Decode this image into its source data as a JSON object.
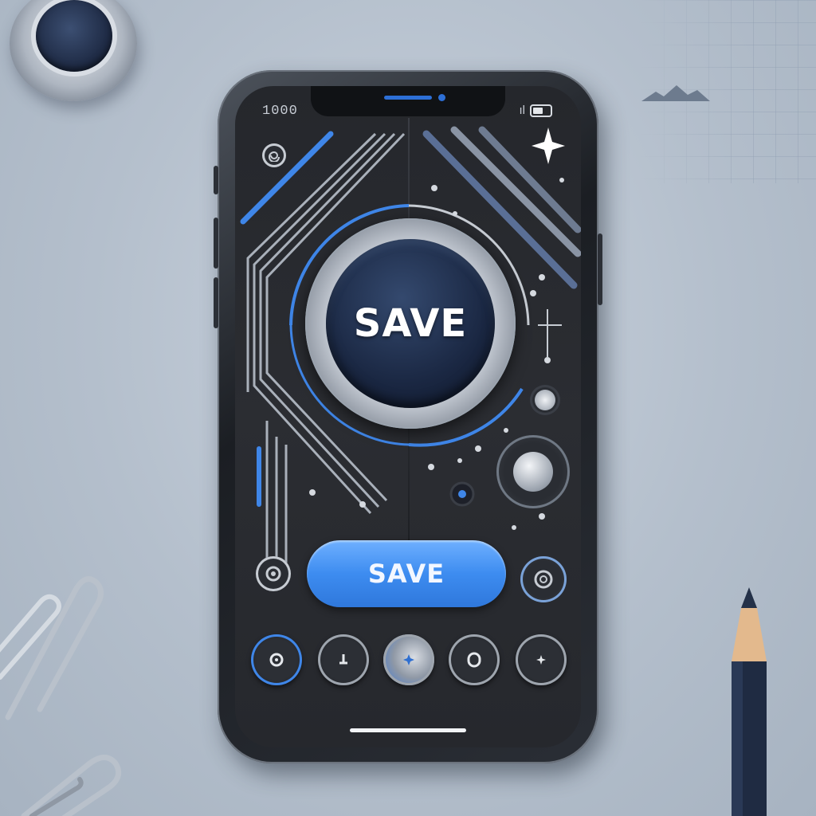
{
  "phone": {
    "status_time": "1000",
    "status_signal": "ıl",
    "main_button_label": "SAVE",
    "pill_button_label": "SAVE"
  },
  "icons": {
    "settings": "spiral-icon",
    "sparkle": "sparkle-icon",
    "target": "target-icon",
    "nav": [
      "target-icon",
      "arrow-down-icon",
      "star-icon",
      "circle-icon",
      "star-icon"
    ]
  },
  "colors": {
    "accent_blue": "#3d8cf0",
    "screen_bg": "#26282d",
    "main_button": "#1a2742"
  }
}
